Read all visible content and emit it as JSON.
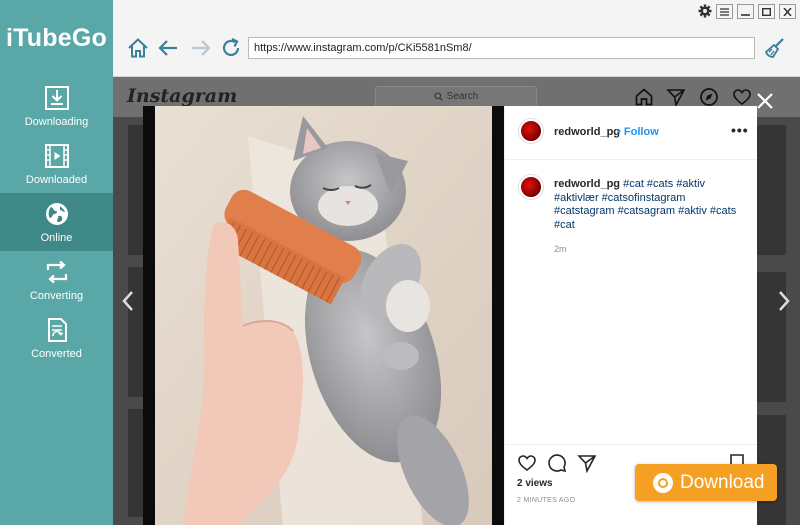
{
  "app": {
    "name": "iTubeGo"
  },
  "sidebar": {
    "items": [
      {
        "label": "Downloading",
        "icon": "downloading-icon"
      },
      {
        "label": "Downloaded",
        "icon": "downloaded-icon"
      },
      {
        "label": "Online",
        "icon": "globe-icon",
        "active": true
      },
      {
        "label": "Converting",
        "icon": "converting-icon"
      },
      {
        "label": "Converted",
        "icon": "converted-icon"
      }
    ]
  },
  "browser": {
    "url": "https://www.instagram.com/p/CKi5581nSm8/"
  },
  "instagram": {
    "logo": "Instagram",
    "search_placeholder": "Search",
    "post": {
      "username": "redworld_pg",
      "separator": "•",
      "follow": "Follow",
      "more": "•••",
      "caption_user": "redworld_pg",
      "caption_tags": "#cat #cats #aktiv #aktivlær #catsofinstagram #catstagram #catsagram #aktiv #cats #cat",
      "age": "2m",
      "views": "2 views",
      "timestamp": "2 MINUTES AGO"
    }
  },
  "download_button": {
    "label": "Download"
  },
  "colors": {
    "sidebar": "#5aa7a7",
    "sidebar_active": "#3f8888",
    "accent": "#f5a023",
    "follow_blue": "#1a95f6"
  }
}
